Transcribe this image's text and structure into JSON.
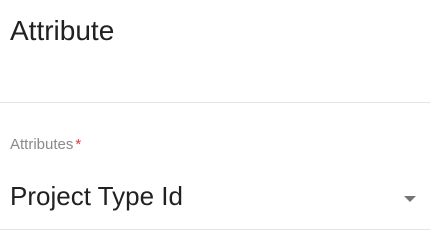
{
  "header": {
    "title": "Attribute"
  },
  "attributes_field": {
    "label": "Attributes",
    "required_marker": "*",
    "selected_value": "Project Type Id",
    "caret_icon": "caret-down-icon"
  },
  "colors": {
    "required": "#e53935",
    "label": "#8a8a8a",
    "text": "#212121",
    "divider": "#e3e3e3"
  }
}
